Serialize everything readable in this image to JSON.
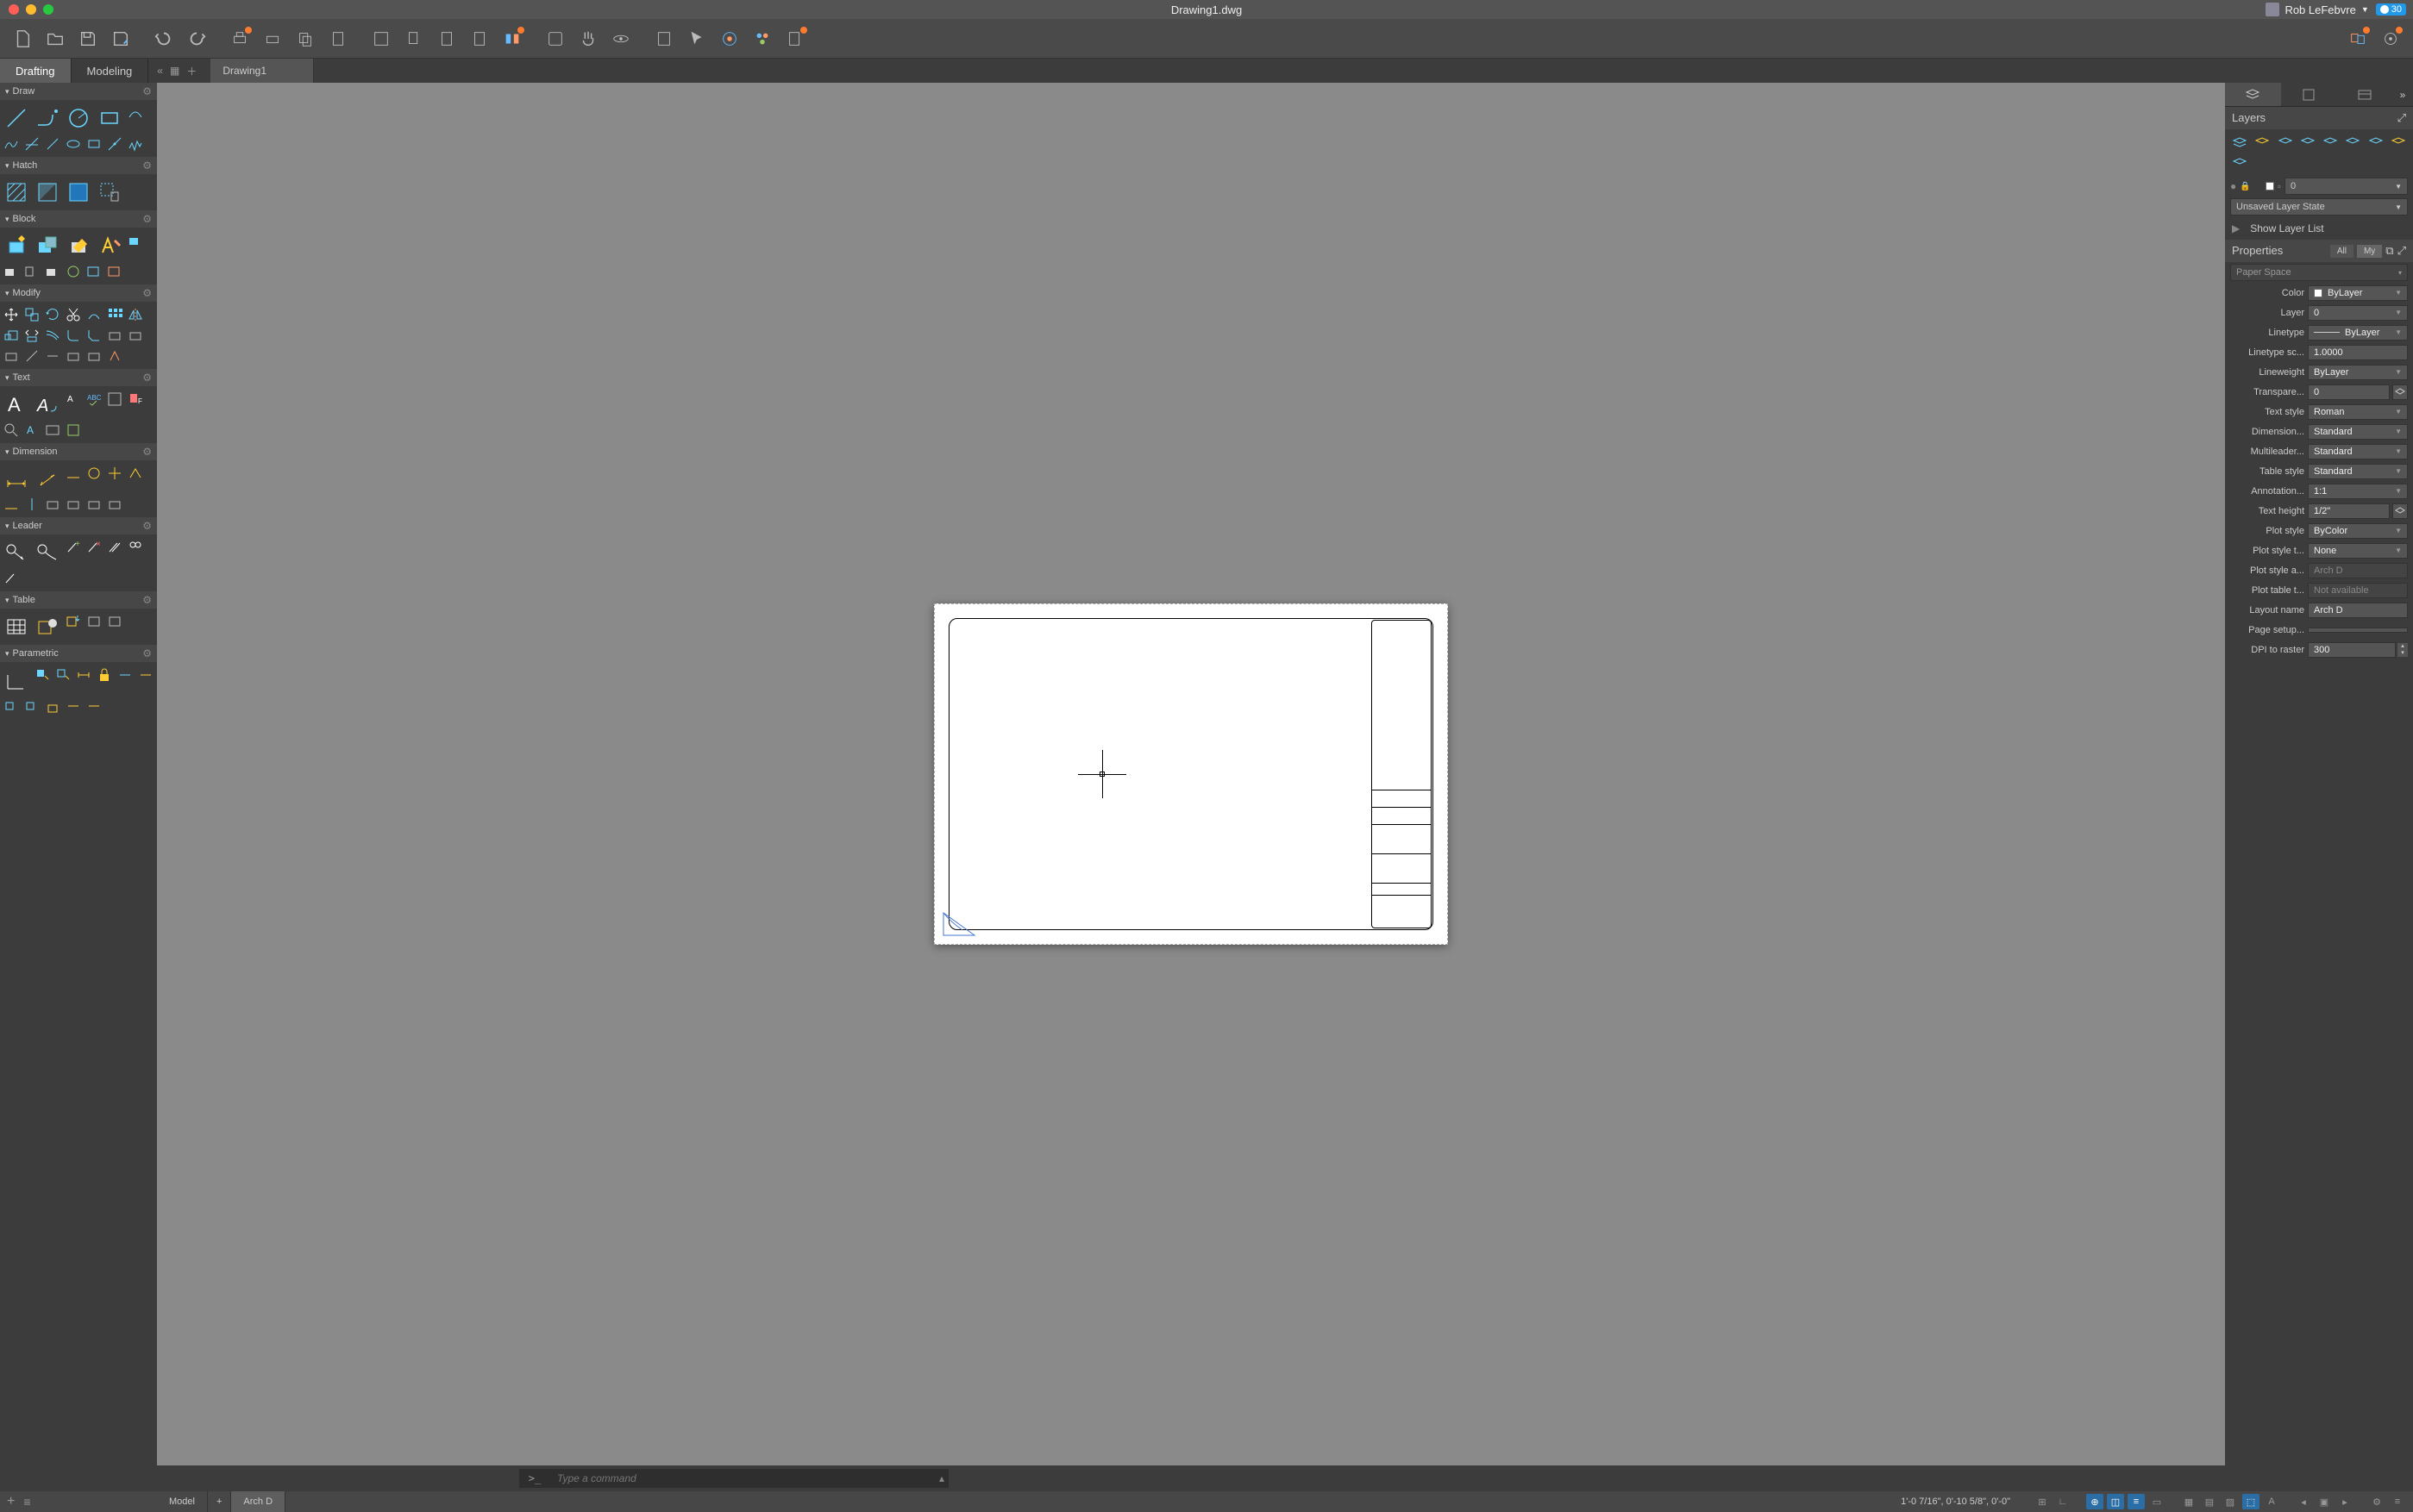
{
  "titlebar": {
    "document": "Drawing1.dwg",
    "user": "Rob LeFebvre",
    "badge": "30"
  },
  "workspace": {
    "tabs": [
      "Drafting",
      "Modeling"
    ],
    "active": "Drafting",
    "docTabs": [
      "Drawing1"
    ]
  },
  "palettes": {
    "draw": {
      "title": "Draw"
    },
    "hatch": {
      "title": "Hatch"
    },
    "block": {
      "title": "Block"
    },
    "modify": {
      "title": "Modify"
    },
    "text": {
      "title": "Text"
    },
    "dimension": {
      "title": "Dimension"
    },
    "leader": {
      "title": "Leader"
    },
    "table": {
      "title": "Table"
    },
    "parametric": {
      "title": "Parametric"
    }
  },
  "rightPanel": {
    "layersTitle": "Layers",
    "layerState": "Unsaved Layer State",
    "currentLayer": "0",
    "showLayerList": "Show Layer List",
    "propertiesTitle": "Properties",
    "propTabs": {
      "all": "All",
      "my": "My"
    },
    "selectionHeader": "Paper Space",
    "props": [
      {
        "label": "Color",
        "value": "ByLayer",
        "swatch": true,
        "dd": true
      },
      {
        "label": "Layer",
        "value": "0",
        "dd": true
      },
      {
        "label": "Linetype",
        "value": "ByLayer",
        "line": true,
        "dd": true
      },
      {
        "label": "Linetype sc...",
        "value": "1.0000"
      },
      {
        "label": "Lineweight",
        "value": "ByLayer",
        "dd": true
      },
      {
        "label": "Transpare...",
        "value": "0",
        "extra": true
      },
      {
        "label": "Text style",
        "value": "Roman",
        "dd": true
      },
      {
        "label": "Dimension...",
        "value": "Standard",
        "dd": true
      },
      {
        "label": "Multileader...",
        "value": "Standard",
        "dd": true
      },
      {
        "label": "Table style",
        "value": "Standard",
        "dd": true
      },
      {
        "label": "Annotation...",
        "value": "1:1",
        "dd": true
      },
      {
        "label": "Text height",
        "value": "1/2\"",
        "extra": true
      },
      {
        "label": "Plot style",
        "value": "ByColor",
        "dd": true
      },
      {
        "label": "Plot style t...",
        "value": "None",
        "dd": true
      },
      {
        "label": "Plot style a...",
        "value": "Arch D",
        "ro": true
      },
      {
        "label": "Plot table t...",
        "value": "Not available",
        "ro": true
      },
      {
        "label": "Layout name",
        "value": "Arch D"
      },
      {
        "label": "Page setup...",
        "value": ""
      },
      {
        "label": "DPI to raster",
        "value": "300",
        "spinner": true
      }
    ]
  },
  "command": {
    "prompt": ">_",
    "placeholder": "Type a command"
  },
  "status": {
    "modelTabs": [
      "Model",
      "+",
      "Arch D"
    ],
    "activeModelTab": "Arch D",
    "coords": "1'-0 7/16\", 0'-10 5/8\", 0'-0\""
  }
}
